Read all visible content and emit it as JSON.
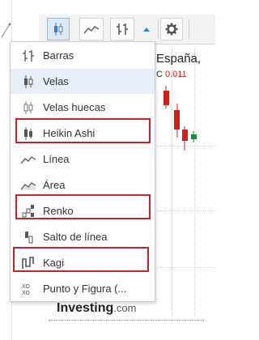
{
  "toolbar": {
    "buttons": [
      {
        "name": "candles-chart-button",
        "icon": "candlestick-icon",
        "active": true
      },
      {
        "name": "area-chart-button",
        "icon": "area-chart-icon",
        "active": false
      },
      {
        "name": "bars-chart-button",
        "icon": "ohlc-bars-icon",
        "active": false
      },
      {
        "name": "chart-type-dropdown-button",
        "icon": "chevron-up-icon",
        "active": false
      },
      {
        "name": "settings-button",
        "icon": "gear-icon",
        "active": false
      }
    ]
  },
  "chart": {
    "title": "España,",
    "change_label": "C",
    "change_value": "0.011",
    "colors": {
      "down": "#d0201a",
      "up": "#1a8a3a",
      "highlight": "#c8232c",
      "accent": "#3a7bd5"
    }
  },
  "menu": {
    "items": [
      {
        "label": "Barras",
        "icon": "ohlc-bars-icon",
        "highlighted": false,
        "hover": false
      },
      {
        "label": "Velas",
        "icon": "candlestick-icon",
        "highlighted": false,
        "hover": true
      },
      {
        "label": "Velas huecas",
        "icon": "hollow-candlestick-icon",
        "highlighted": false,
        "hover": false
      },
      {
        "label": "Heikin Ashi",
        "icon": "heikin-ashi-icon",
        "highlighted": true,
        "hover": false
      },
      {
        "label": "Línea",
        "icon": "line-chart-icon",
        "highlighted": false,
        "hover": false
      },
      {
        "label": "Área",
        "icon": "area-chart-icon",
        "highlighted": false,
        "hover": false
      },
      {
        "label": "Renko",
        "icon": "renko-icon",
        "highlighted": true,
        "hover": false
      },
      {
        "label": "Salto de línea",
        "icon": "line-break-icon",
        "highlighted": false,
        "hover": false
      },
      {
        "label": "Kagi",
        "icon": "kagi-icon",
        "highlighted": true,
        "hover": false
      },
      {
        "label": "Punto y Figura (...",
        "icon": "point-and-figure-icon",
        "highlighted": false,
        "hover": false
      }
    ]
  },
  "footer": {
    "logo_main": "Investing",
    "logo_domain": ".com"
  }
}
